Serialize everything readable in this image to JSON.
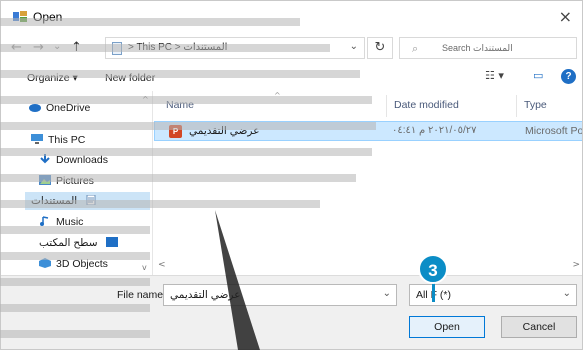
{
  "window": {
    "title": "Open",
    "close_glyph": "×"
  },
  "nav": {
    "back_glyph": "←",
    "forward_glyph": "→",
    "recent_glyph": "⌄",
    "up_glyph": "↑",
    "address_path": "> This PC > المستندات",
    "address_dropdown_glyph": "⌄",
    "refresh_glyph": "↻",
    "search_icon_glyph": "⌕",
    "search_placeholder": "Search المستندات"
  },
  "toolbar": {
    "organize_label": "Organize ▾",
    "new_folder_label": "New folder",
    "view_glyph": "☷ ▾",
    "preview_glyph": "▭",
    "help_glyph": "?"
  },
  "sidebar": {
    "items": [
      {
        "label": "OneDrive",
        "icon": "cloud-icon"
      },
      {
        "label": "This PC",
        "icon": "computer-icon"
      },
      {
        "label": "Downloads",
        "icon": "download-icon"
      },
      {
        "label": "Pictures",
        "icon": "pictures-icon"
      },
      {
        "label": "المستندات",
        "icon": "documents-icon"
      },
      {
        "label": "Music",
        "icon": "music-icon"
      },
      {
        "label": "سطح المكتب",
        "icon": "desktop-icon"
      },
      {
        "label": "3D Objects",
        "icon": "3d-objects-icon"
      }
    ],
    "scroll_up_glyph": "^",
    "scroll_down_glyph": "v"
  },
  "filelist": {
    "columns": {
      "name": "Name",
      "date": "Date modified",
      "type": "Type"
    },
    "sort_caret": "^",
    "rows": [
      {
        "name": "عرضي التقديمي",
        "date": "٢٠٢١/٠٥/٢٧ م ٠٤:٤١",
        "type": "Microsoft Po",
        "icon": "powerpoint-file-icon",
        "icon_glyph": "P"
      }
    ],
    "hscroll_left_glyph": "<",
    "hscroll_right_glyph": ">"
  },
  "bottom": {
    "file_name_label": "File name:",
    "file_name_value": "عرضي التقديمي",
    "file_name_dropdown_glyph": "⌄",
    "file_type_value": "All F     (*)",
    "file_type_dropdown_glyph": "⌄",
    "open_label": "Open",
    "cancel_label": "Cancel"
  },
  "callout": {
    "step_number": "3",
    "color": "#0b8dc6"
  },
  "colors": {
    "selection": "#cce8ff",
    "accent": "#0078d7",
    "powerpoint": "#d24726",
    "watermark": "#c8c8c8"
  }
}
